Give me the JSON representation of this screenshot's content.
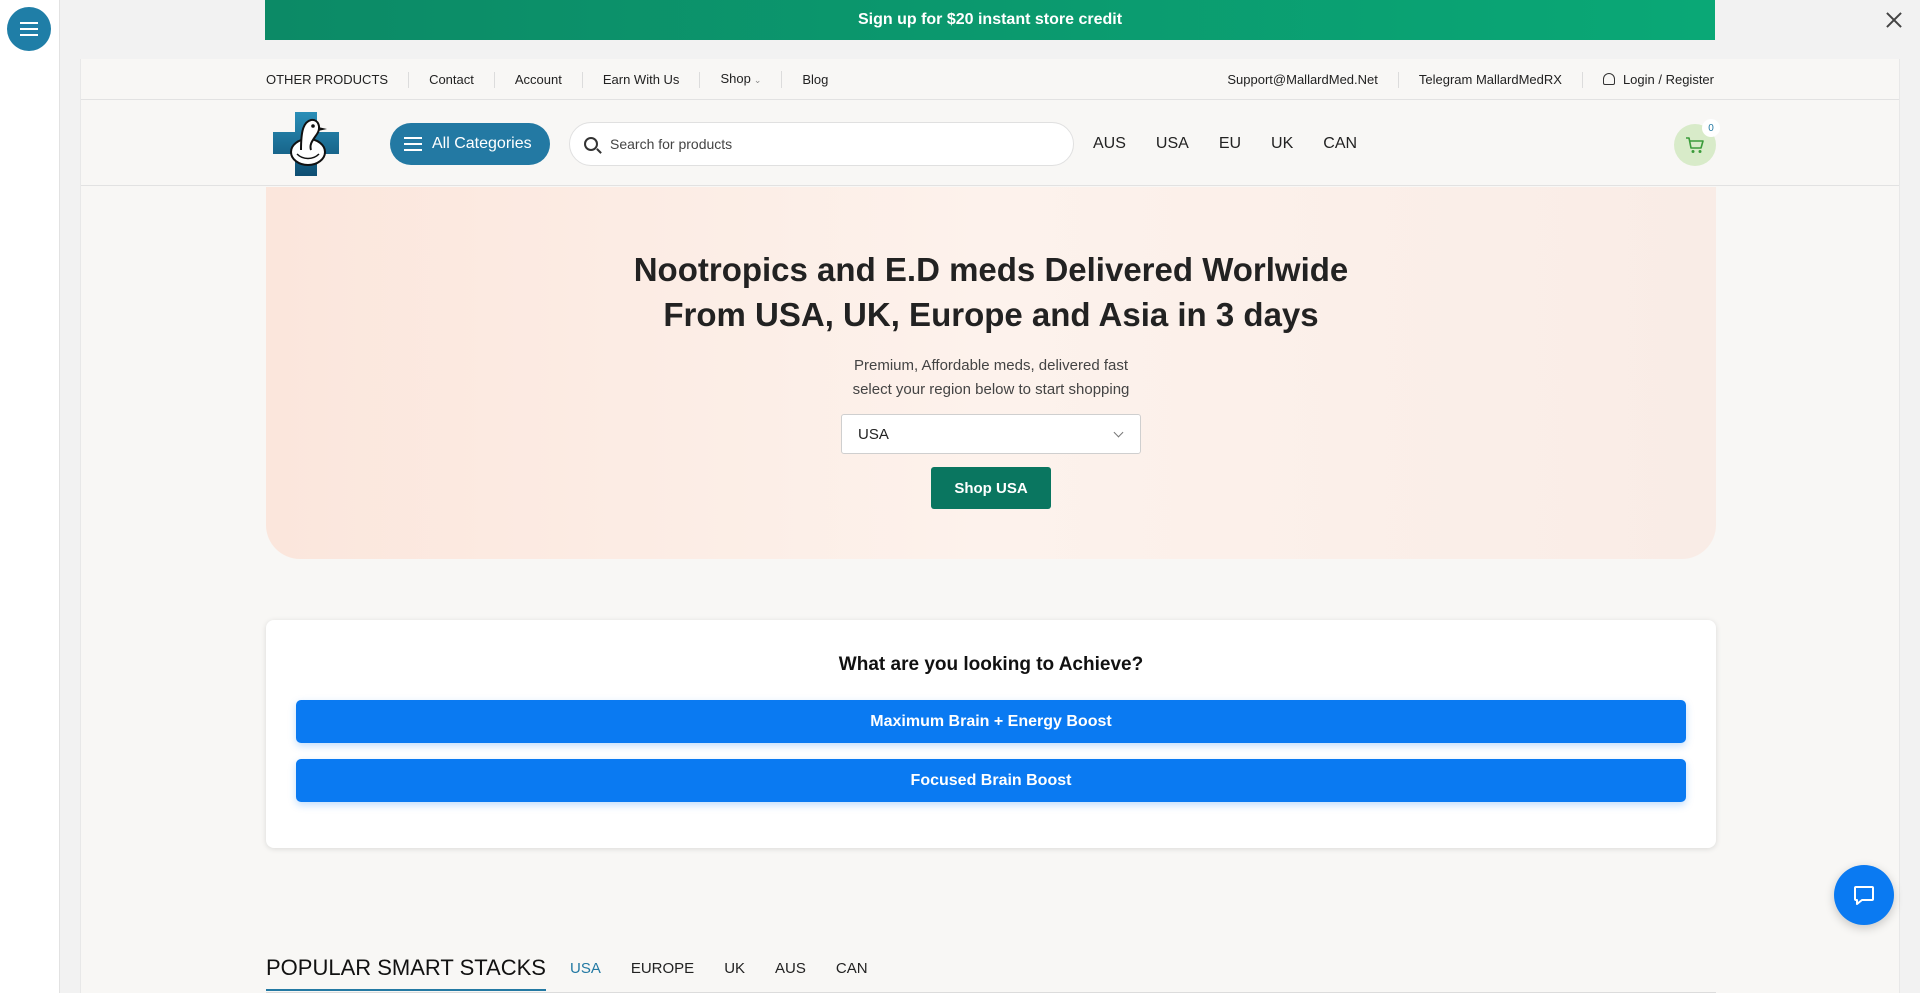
{
  "banner": {
    "text": "Sign up for $20 instant store credit"
  },
  "utility_bar": {
    "left": [
      "OTHER PRODUCTS",
      "Contact",
      "Account",
      "Earn With Us",
      "Shop",
      "Blog"
    ],
    "support_email": "Support@MallardMed.Net",
    "telegram": "Telegram MallardMedRX",
    "login": "Login / Register"
  },
  "header": {
    "categories_label": "All Categories",
    "search_placeholder": "Search for products",
    "regions": [
      "AUS",
      "USA",
      "EU",
      "UK",
      "CAN"
    ],
    "cart_count": "0"
  },
  "hero": {
    "title_line1": "Nootropics and E.D meds Delivered Worlwide",
    "title_line2": "From USA, UK, Europe and Asia in 3 days",
    "subtitle_line1": "Premium, Affordable meds, delivered fast",
    "subtitle_line2": "select your region below to start shopping",
    "selected_region": "USA",
    "shop_button": "Shop USA"
  },
  "achieve": {
    "title": "What are you looking to Achieve?",
    "options": [
      "Maximum Brain + Energy Boost",
      "Focused Brain Boost"
    ]
  },
  "popular": {
    "title": "POPULAR SMART STACKS",
    "tabs": [
      "USA",
      "EUROPE",
      "UK",
      "AUS",
      "CAN"
    ],
    "active_tab": "USA"
  },
  "colors": {
    "brand_blue": "#2379a3",
    "banner_green": "#0aa876",
    "shop_green": "#0a7660",
    "cta_blue": "#0a7af2"
  },
  "icons": [
    "menu-icon",
    "close-icon",
    "user-icon",
    "search-icon",
    "cart-icon",
    "chevron-down-icon",
    "chat-icon",
    "logo-duck-icon"
  ]
}
